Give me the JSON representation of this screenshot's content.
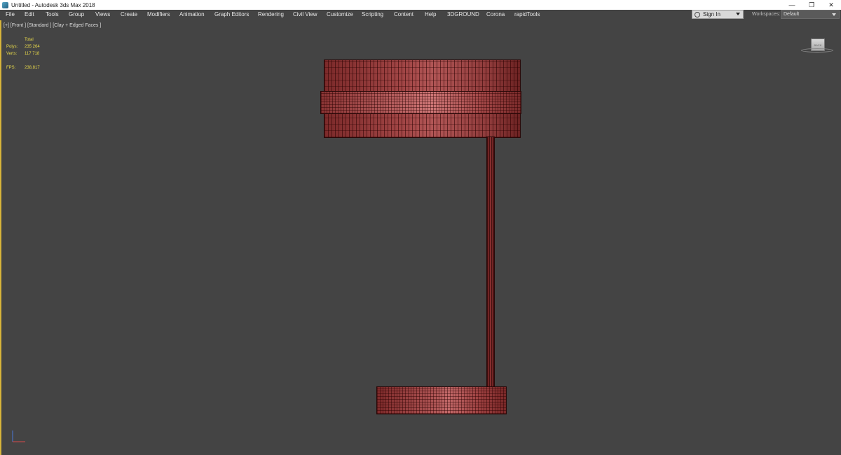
{
  "window": {
    "title": "Untitled - Autodesk 3ds Max 2018",
    "controls": [
      "—",
      "❐",
      "✕"
    ]
  },
  "menu": {
    "items": [
      "File",
      "Edit",
      "Tools",
      "Group",
      "Views",
      "Create",
      "Modifiers",
      "Animation",
      "Graph Editors",
      "Rendering",
      "Civil View",
      "Customize",
      "Scripting",
      "Content",
      "Help",
      "3DGROUND",
      "Corona",
      "rapidTools"
    ]
  },
  "account": {
    "signin_label": "Sign In",
    "workspaces_label": "Workspaces:",
    "workspace_value": "Default"
  },
  "viewport": {
    "label": "[+] [Front ] [Standard ] [Clay + Edged Faces ]",
    "stats": {
      "header": "Total",
      "polys_label": "Polys:",
      "polys_value": "235 264",
      "verts_label": "Verts:",
      "verts_value": "117 718",
      "fps_label": "FPS:",
      "fps_value": "238,817"
    },
    "viewcube_face": "BACK"
  },
  "colors": {
    "viewport_bg": "#444444",
    "active_border": "#d8b43a",
    "stats_text": "#e8d94a",
    "mesh_red": "#a14545"
  }
}
